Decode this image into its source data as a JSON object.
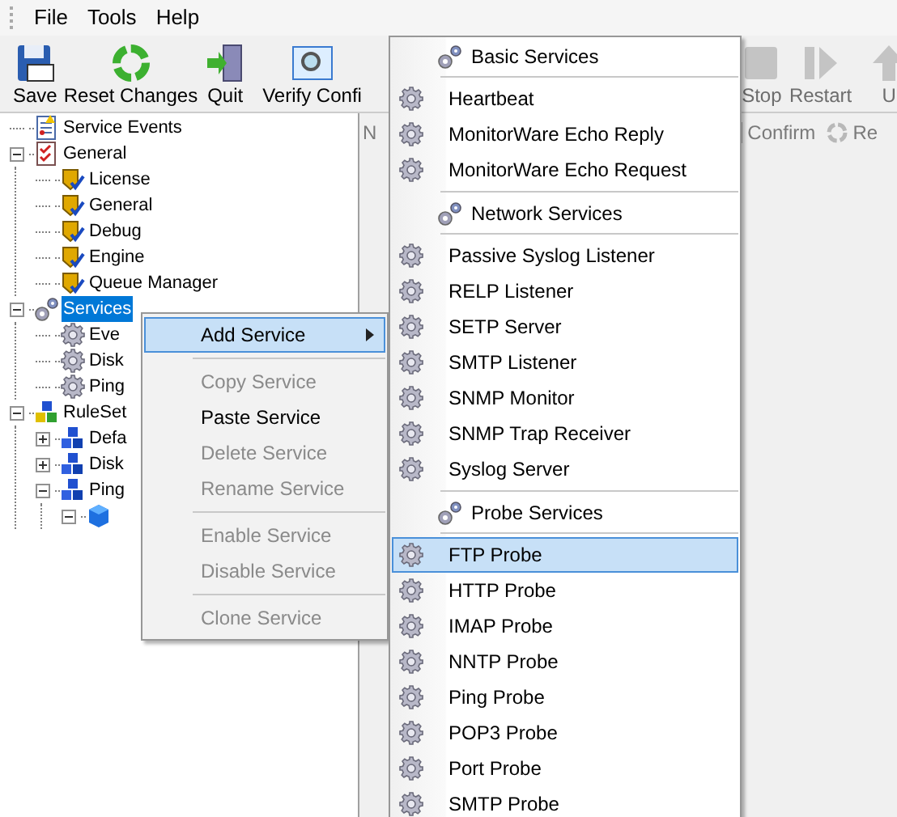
{
  "menu_bar": [
    "File",
    "Tools",
    "Help"
  ],
  "toolbar": [
    {
      "label": "Save",
      "kind": "save",
      "disabled": false
    },
    {
      "label": "Reset Changes",
      "kind": "reset",
      "disabled": false
    },
    {
      "label": "Quit",
      "kind": "quit",
      "disabled": false
    },
    {
      "kind": "separator"
    },
    {
      "label": "Verify Confi",
      "kind": "verify",
      "disabled": false
    },
    {
      "kind": "gap"
    },
    {
      "label": "Stop",
      "kind": "stop",
      "disabled": true
    },
    {
      "label": "Restart",
      "kind": "restart",
      "disabled": true
    },
    {
      "kind": "separator"
    },
    {
      "label": "U",
      "kind": "up",
      "disabled": true
    }
  ],
  "secondary_toolbar": [
    {
      "label": "N",
      "kind": "plain"
    },
    {
      "label": "Confirm",
      "kind": "confirm"
    },
    {
      "label": "Re",
      "kind": "refresh"
    }
  ],
  "tree": [
    {
      "label": "Service Events",
      "kind": "events",
      "selected": false
    },
    {
      "label": "General",
      "kind": "checklist",
      "selected": false,
      "expanded": true,
      "children": [
        {
          "label": "License",
          "kind": "shield",
          "selected": false
        },
        {
          "label": "General",
          "kind": "shield",
          "selected": false
        },
        {
          "label": "Debug",
          "kind": "shield",
          "selected": false
        },
        {
          "label": "Engine",
          "kind": "shield",
          "selected": false
        },
        {
          "label": "Queue Manager",
          "kind": "shield",
          "selected": false
        }
      ]
    },
    {
      "label": "Services",
      "kind": "gears",
      "selected": true,
      "expanded": true,
      "children": [
        {
          "label": "Eve",
          "kind": "gear",
          "selected": false
        },
        {
          "label": "Disk",
          "kind": "gear",
          "selected": false
        },
        {
          "label": "Ping",
          "kind": "gear",
          "selected": false
        }
      ]
    },
    {
      "label": "RuleSet",
      "kind": "ruleset",
      "selected": false,
      "expanded": true,
      "children": [
        {
          "label": "Defa",
          "kind": "blocks",
          "selected": false,
          "expanded": false
        },
        {
          "label": "Disk",
          "kind": "blocks",
          "selected": false,
          "expanded": false
        },
        {
          "label": "Ping",
          "kind": "blocks",
          "selected": false,
          "expanded": true,
          "children": [
            {
              "kind": "cube",
              "expanded": true
            }
          ]
        }
      ]
    }
  ],
  "context_menu": {
    "items": [
      {
        "kind": "item",
        "label": "Add Service",
        "disabled": false,
        "selected": true,
        "submenu": true
      },
      {
        "kind": "separator"
      },
      {
        "kind": "item",
        "label": "Copy Service",
        "disabled": true,
        "selected": false
      },
      {
        "kind": "item",
        "label": "Paste Service",
        "disabled": false,
        "selected": false
      },
      {
        "kind": "item",
        "label": "Delete Service",
        "disabled": true,
        "selected": false
      },
      {
        "kind": "item",
        "label": "Rename Service",
        "disabled": true,
        "selected": false
      },
      {
        "kind": "separator"
      },
      {
        "kind": "item",
        "label": "Enable Service",
        "disabled": true,
        "selected": false
      },
      {
        "kind": "item",
        "label": "Disable Service",
        "disabled": true,
        "selected": false
      },
      {
        "kind": "separator"
      },
      {
        "kind": "item",
        "label": "Clone Service",
        "disabled": true,
        "selected": false
      }
    ]
  },
  "submenu": {
    "items": [
      {
        "kind": "header",
        "label": "Basic Services"
      },
      {
        "kind": "separator"
      },
      {
        "kind": "item",
        "label": "Heartbeat",
        "selected": false
      },
      {
        "kind": "item",
        "label": "MonitorWare Echo Reply",
        "selected": false
      },
      {
        "kind": "item",
        "label": "MonitorWare Echo Request",
        "selected": false
      },
      {
        "kind": "separator"
      },
      {
        "kind": "header",
        "label": "Network Services"
      },
      {
        "kind": "separator"
      },
      {
        "kind": "item",
        "label": "Passive Syslog Listener",
        "selected": false
      },
      {
        "kind": "item",
        "label": "RELP Listener",
        "selected": false
      },
      {
        "kind": "item",
        "label": "SETP Server",
        "selected": false
      },
      {
        "kind": "item",
        "label": "SMTP Listener",
        "selected": false
      },
      {
        "kind": "item",
        "label": "SNMP Monitor",
        "selected": false
      },
      {
        "kind": "item",
        "label": "SNMP Trap Receiver",
        "selected": false
      },
      {
        "kind": "item",
        "label": "Syslog Server",
        "selected": false
      },
      {
        "kind": "separator"
      },
      {
        "kind": "header",
        "label": "Probe Services"
      },
      {
        "kind": "separator"
      },
      {
        "kind": "item",
        "label": "FTP Probe",
        "selected": true
      },
      {
        "kind": "item",
        "label": "HTTP Probe",
        "selected": false
      },
      {
        "kind": "item",
        "label": "IMAP Probe",
        "selected": false
      },
      {
        "kind": "item",
        "label": "NNTP Probe",
        "selected": false
      },
      {
        "kind": "item",
        "label": "Ping Probe",
        "selected": false
      },
      {
        "kind": "item",
        "label": "POP3 Probe",
        "selected": false
      },
      {
        "kind": "item",
        "label": "Port Probe",
        "selected": false
      },
      {
        "kind": "item",
        "label": "SMTP Probe",
        "selected": false
      }
    ]
  }
}
